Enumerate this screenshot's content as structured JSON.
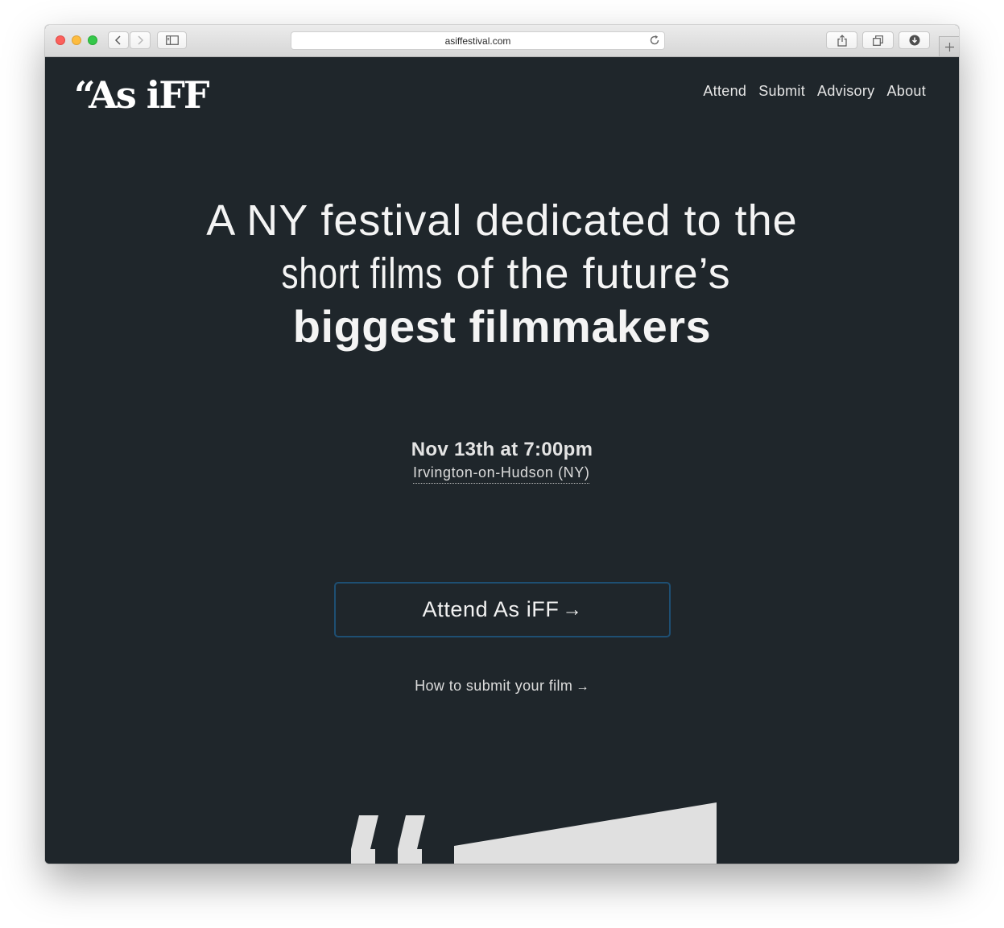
{
  "browser": {
    "url": "asiffestival.com"
  },
  "site": {
    "logo": "“As iFF",
    "nav": [
      {
        "label": "Attend"
      },
      {
        "label": "Submit"
      },
      {
        "label": "Advisory"
      },
      {
        "label": "About"
      }
    ]
  },
  "hero": {
    "headline_line1": "A NY festival dedicated to the",
    "headline_line2_condensed": "short films",
    "headline_line2_rest": " of the future’s",
    "headline_line3": "biggest filmmakers"
  },
  "event": {
    "date": "Nov 13th at 7:00pm",
    "location": "Irvington-on-Hudson (NY)"
  },
  "actions": {
    "attend_label": "Attend As iFF",
    "attend_arrow": "→",
    "submit_label": "How to submit your film",
    "submit_arrow": "→"
  },
  "colors": {
    "page_background": "#1f262b",
    "button_border": "#1e4f73",
    "text": "#f2f2f2",
    "graphic": "#e0e0e0"
  },
  "icons": {
    "back": "chevron-left-icon",
    "forward": "chevron-right-icon",
    "sidebar": "sidebar-icon",
    "reload": "reload-icon",
    "share": "share-icon",
    "tabs": "tabs-icon",
    "downloads": "download-icon",
    "new_tab": "plus-icon"
  }
}
